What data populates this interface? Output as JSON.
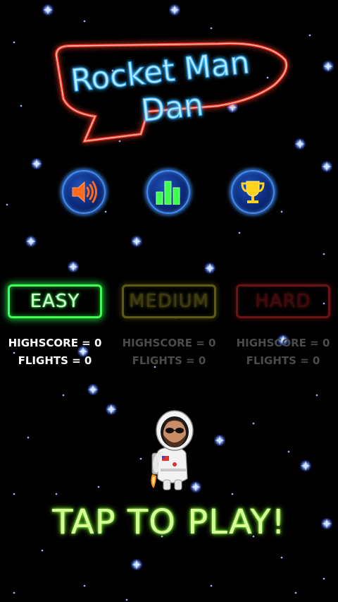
{
  "game": {
    "title_line1": "Rocket Man",
    "title_line2": "Dan",
    "tap_to_play": "TAP TO PLAY!"
  },
  "icon_buttons": [
    {
      "name": "sound",
      "icon": "speaker-icon",
      "color": "#ff6a1e"
    },
    {
      "name": "leaderboard",
      "icon": "bar-chart-icon",
      "color": "#3dff4d"
    },
    {
      "name": "achievements",
      "icon": "trophy-icon",
      "color": "#ffd21e"
    }
  ],
  "difficulties": [
    {
      "label": "EASY",
      "highscore": "HIGHSCORE = 0",
      "flights": "FLIGHTS = 0",
      "selected": true,
      "color": "#40ff55"
    },
    {
      "label": "MEDIUM",
      "highscore": "HIGHSCORE = 0",
      "flights": "FLIGHTS = 0",
      "selected": false,
      "color": "#5e5a12"
    },
    {
      "label": "HARD",
      "highscore": "HIGHSCORE = 0",
      "flights": "FLIGHTS = 0",
      "selected": false,
      "color": "#6b1212"
    }
  ],
  "colors": {
    "background": "#000000",
    "logo_outline": "#ff3a2a",
    "logo_text": "#7fd6ff",
    "star": "#8fb8ff"
  }
}
